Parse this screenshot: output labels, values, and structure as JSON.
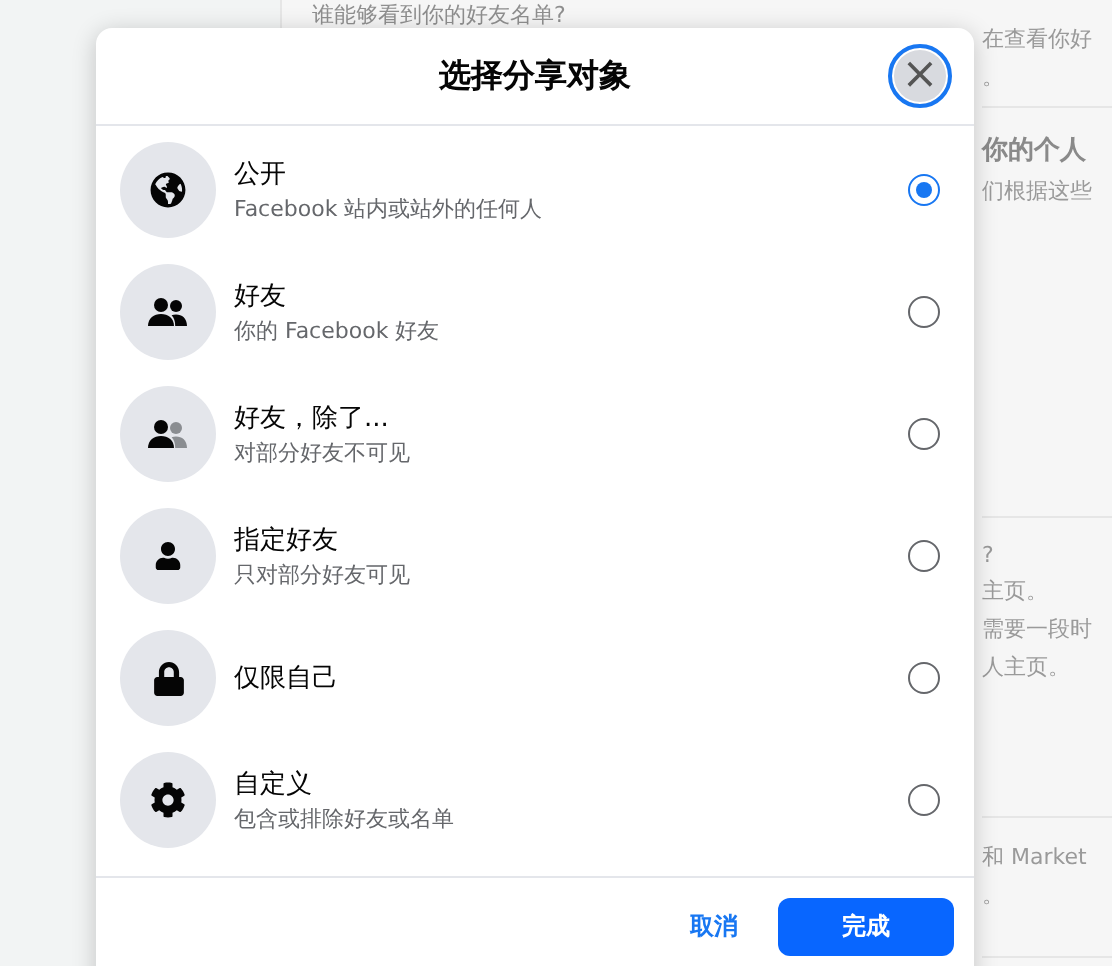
{
  "background": {
    "top_heading": "谁能够看到你的好友名单?",
    "side_sections": [
      {
        "lines": [
          {
            "text": "在查看你好",
            "kind": "plain"
          },
          {
            "text": "。",
            "kind": "plain"
          }
        ]
      },
      {
        "lines": [
          {
            "text": "你的个人",
            "kind": "heading"
          },
          {
            "text": "们根据这些",
            "kind": "plain"
          }
        ]
      },
      {
        "lines": [
          {
            "text": "?",
            "kind": "plain"
          },
          {
            "text": "主页。",
            "kind": "plain"
          },
          {
            "text": "需要一段时",
            "kind": "plain"
          },
          {
            "text": "人主页。",
            "kind": "plain"
          }
        ]
      },
      {
        "lines": [
          {
            "text": "和 Market",
            "kind": "plain"
          },
          {
            "text": "。",
            "kind": "plain"
          }
        ]
      }
    ]
  },
  "dialog": {
    "title": "选择分享对象",
    "close_label": "×",
    "options": [
      {
        "kind": "globe",
        "title": "公开",
        "subtitle": "Facebook 站内或站外的任何人",
        "selected": true
      },
      {
        "kind": "friends",
        "title": "好友",
        "subtitle": "你的 Facebook 好友",
        "selected": false
      },
      {
        "kind": "friends_except",
        "title": "好友，除了...",
        "subtitle": "对部分好友不可见",
        "selected": false
      },
      {
        "kind": "person",
        "title": "指定好友",
        "subtitle": "只对部分好友可见",
        "selected": false
      },
      {
        "kind": "lock",
        "title": "仅限自己",
        "selected": false
      },
      {
        "kind": "gear",
        "title": "自定义",
        "subtitle": "包含或排除好友或名单",
        "selected": false
      }
    ],
    "cancel": "取消",
    "done": "完成"
  }
}
